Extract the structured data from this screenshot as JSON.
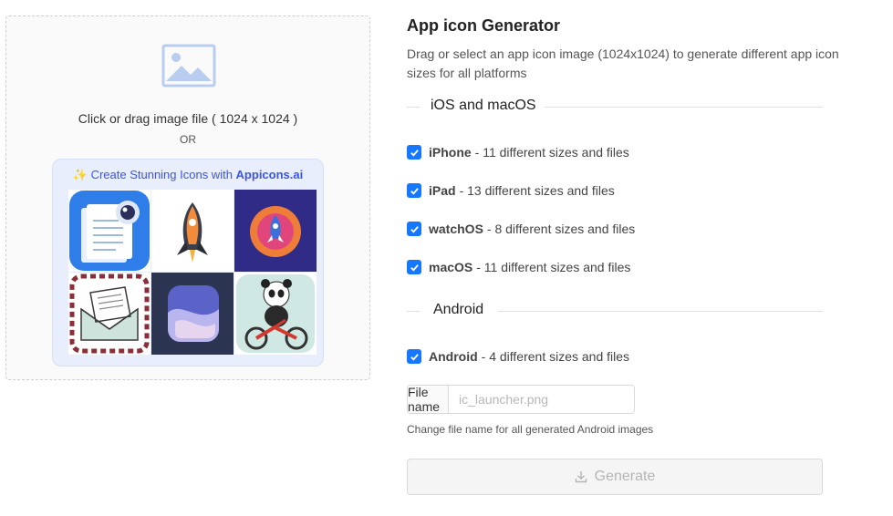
{
  "upload": {
    "prompt": "Click or drag image file ( 1024 x 1024 )",
    "or_text": "OR",
    "promo_prefix": "✨ Create Stunning Icons with ",
    "promo_brand": "Appicons.ai",
    "icon_tiles": [
      "notes-camera-app-icon",
      "rocket-app-icon",
      "rocket-circle-app-icon",
      "envelope-app-icon",
      "abstract-wave-app-icon",
      "panda-bike-app-icon"
    ]
  },
  "header": {
    "title": "App icon Generator",
    "description": "Drag or select an app icon image (1024x1024) to generate different app icon sizes for all platforms"
  },
  "sections": {
    "ios_label": "iOS and macOS",
    "android_label": "Android"
  },
  "platforms": [
    {
      "name": "iPhone",
      "detail": "- 11 different sizes and files",
      "checked": true
    },
    {
      "name": "iPad",
      "detail": "- 13 different sizes and files",
      "checked": true
    },
    {
      "name": "watchOS",
      "detail": "- 8 different sizes and files",
      "checked": true
    },
    {
      "name": "macOS",
      "detail": "- 11 different sizes and files",
      "checked": true
    },
    {
      "name": "Android",
      "detail": "- 4 different sizes and files",
      "checked": true
    }
  ],
  "android": {
    "file_name_label": "File name",
    "file_name_placeholder": "ic_launcher.png",
    "file_name_value": "",
    "hint": "Change file name for all generated Android images"
  },
  "actions": {
    "generate_label": "Generate"
  },
  "colors": {
    "accent": "#1677ff",
    "promo_text": "#3b55e6"
  }
}
